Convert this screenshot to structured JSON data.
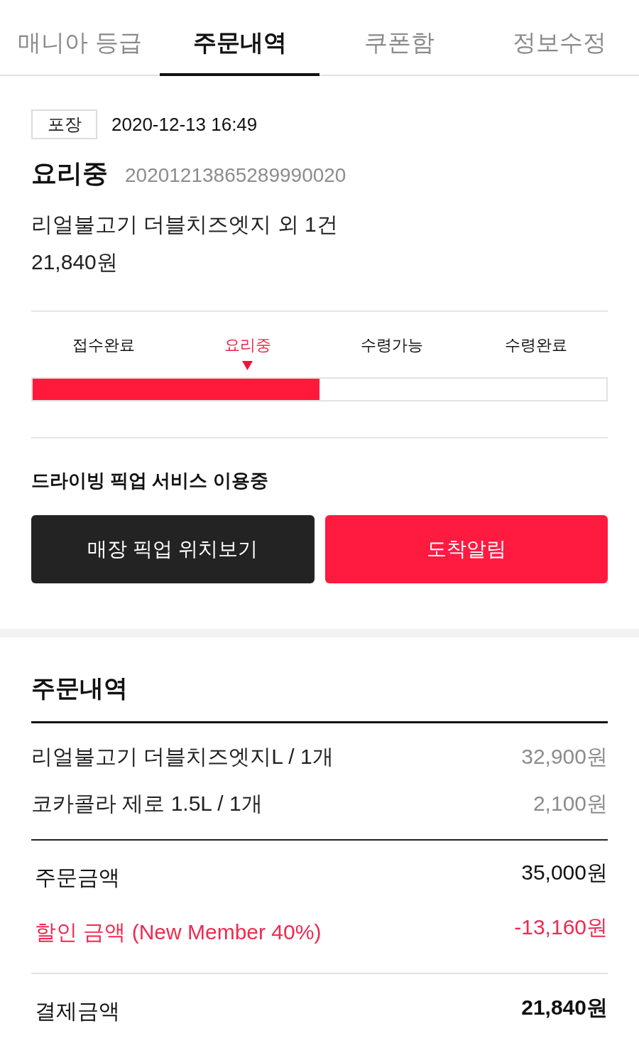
{
  "tabs": [
    {
      "label": "매니아 등급",
      "selected": false
    },
    {
      "label": "주문내역",
      "selected": true
    },
    {
      "label": "쿠폰함",
      "selected": false
    },
    {
      "label": "정보수정",
      "selected": false
    }
  ],
  "order": {
    "type_tag": "포장",
    "date": "2020-12-13 16:49",
    "status": "요리중",
    "order_number": "20201213865289990020",
    "summary": "리얼불고기 더블치즈엣지 외 1건",
    "total": "21,840원"
  },
  "progress": {
    "steps": [
      {
        "label": "접수완료",
        "selected": false
      },
      {
        "label": "요리중",
        "selected": true
      },
      {
        "label": "수령가능",
        "selected": false
      },
      {
        "label": "수령완료",
        "selected": false
      }
    ],
    "level": 0.5
  },
  "pickup": {
    "notice": "드라이빙 픽업 서비스 이용중",
    "buttons": [
      {
        "label": "매장 픽업 위치보기",
        "kind": "secondary"
      },
      {
        "label": "도착알림",
        "kind": "primary"
      }
    ]
  },
  "order_details": {
    "title": "주문내역",
    "items": [
      {
        "name": "리얼불고기 더블치즈엣지L / 1개",
        "price": "32,900원"
      },
      {
        "name": "코카콜라 제로 1.5L / 1개",
        "price": "2,100원"
      }
    ],
    "summary_rows": [
      {
        "label": "주문금액",
        "value": "35,000원",
        "kind": "normal"
      },
      {
        "label": "할인 금액 (New Member 40%)",
        "value": "-13,160원",
        "kind": "discount"
      }
    ],
    "payment": {
      "label": "결제금액",
      "value": "21,840원"
    }
  }
}
